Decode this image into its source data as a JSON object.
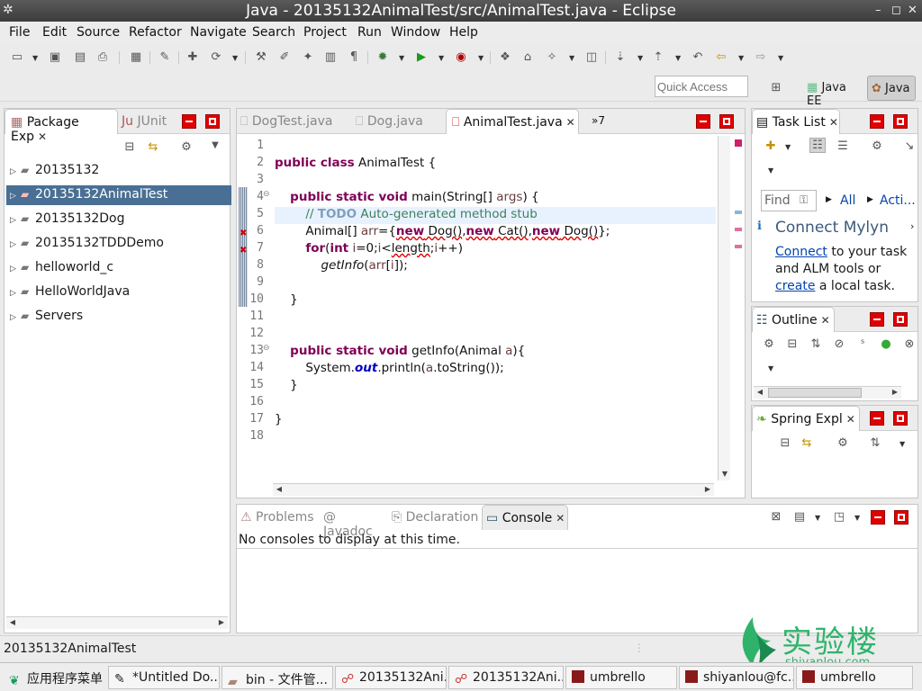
{
  "window": {
    "title": "Java - 20135132AnimalTest/src/AnimalTest.java - Eclipse",
    "controls": [
      "–",
      "◻",
      "✕"
    ]
  },
  "menu": [
    "File",
    "Edit",
    "Source",
    "Refactor",
    "Navigate",
    "Search",
    "Project",
    "Run",
    "Window",
    "Help"
  ],
  "toolbar": {
    "quick_access_placeholder": "Quick Access",
    "perspectives": [
      {
        "label": "Java EE",
        "active": false
      },
      {
        "label": "Java",
        "active": true
      }
    ]
  },
  "package_explorer": {
    "tabs": [
      {
        "label": "Package Exp",
        "active": true
      },
      {
        "label": "JUnit",
        "active": false
      }
    ],
    "tree": [
      {
        "label": "20135132",
        "selected": false
      },
      {
        "label": "20135132AnimalTest",
        "selected": true
      },
      {
        "label": "20135132Dog",
        "selected": false
      },
      {
        "label": "20135132TDDDemo",
        "selected": false
      },
      {
        "label": "helloworld_c",
        "selected": false
      },
      {
        "label": "HelloWorldJava",
        "selected": false
      },
      {
        "label": "Servers",
        "selected": false
      }
    ]
  },
  "editor": {
    "tabs": [
      {
        "label": "DogTest.java",
        "active": false
      },
      {
        "label": "Dog.java",
        "active": false
      },
      {
        "label": "AnimalTest.java",
        "active": true
      }
    ],
    "overflow_label": "»7",
    "line_numbers": [
      "1",
      "2",
      "3",
      "4",
      "5",
      "6",
      "7",
      "8",
      "9",
      "10",
      "11",
      "12",
      "13",
      "14",
      "15",
      "16",
      "17",
      "18"
    ]
  },
  "task_list": {
    "tab": "Task List",
    "find_placeholder": "Find",
    "filter_all": "All",
    "filter_activate": "Acti...",
    "mylyn_title": "Connect Mylyn",
    "mylyn_link_connect": "Connect",
    "mylyn_text_1": " to your task and ALM tools or ",
    "mylyn_link_create": "create",
    "mylyn_text_2": " a local task."
  },
  "outline": {
    "tab": "Outline"
  },
  "spring_explorer": {
    "tab": "Spring Expl"
  },
  "bottom_panel": {
    "tabs": [
      {
        "label": "Problems",
        "active": false
      },
      {
        "label": "Javadoc",
        "active": false
      },
      {
        "label": "Declaration",
        "active": false
      },
      {
        "label": "Console",
        "active": true
      }
    ],
    "console_message": "No consoles to display at this time."
  },
  "status": {
    "text": "20135132AnimalTest"
  },
  "taskbar": [
    {
      "label": "应用程序菜单"
    },
    {
      "label": "*Untitled Do..."
    },
    {
      "label": "bin - 文件管..."
    },
    {
      "label": "20135132Ani..."
    },
    {
      "label": "20135132Ani..."
    },
    {
      "label": "umbrello"
    },
    {
      "label": "shiyanlou@fc..."
    },
    {
      "label": "umbrello"
    }
  ],
  "watermark": {
    "name": "实验楼",
    "url": "shiyanlou.com"
  },
  "colors": {
    "selection": "#4a6f94",
    "keyword": "#7f0055",
    "comment": "#3f7f5f",
    "close_button": "#e00000"
  }
}
